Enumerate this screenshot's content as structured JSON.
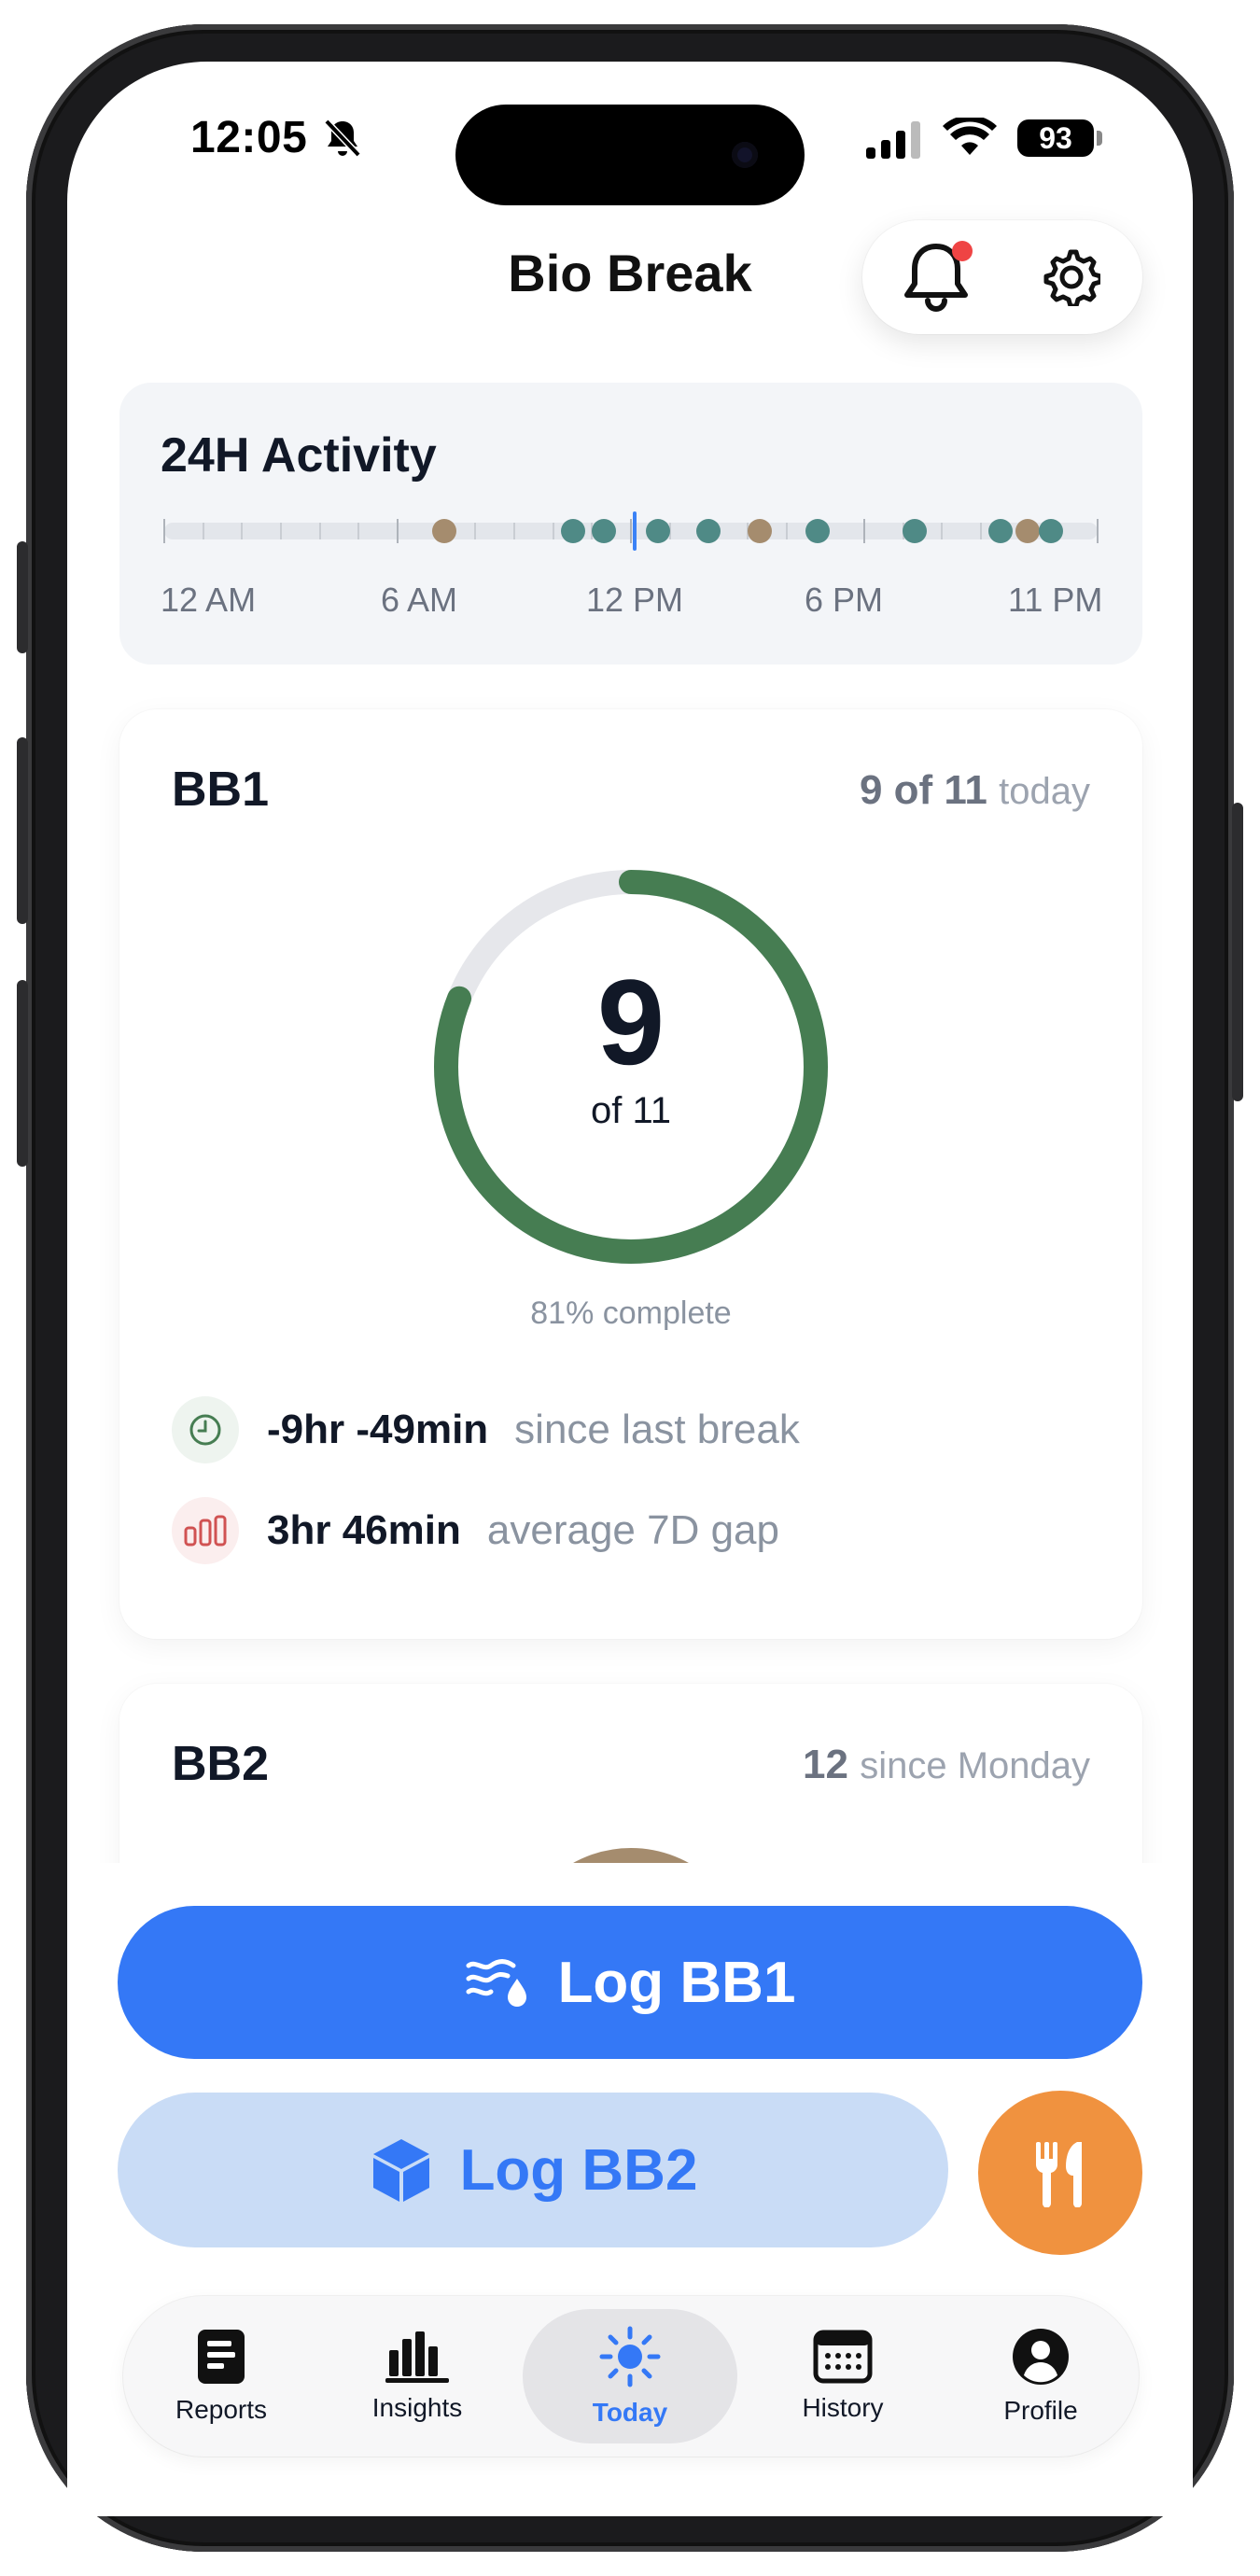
{
  "status_bar": {
    "time": "12:05",
    "battery": "93"
  },
  "header": {
    "title": "Bio Break"
  },
  "activity": {
    "title": "24H Activity",
    "labels": [
      "12 AM",
      "6 AM",
      "12 PM",
      "6 PM",
      "11 PM"
    ],
    "events_hours": [
      {
        "hour": 7.2,
        "type": "bb2"
      },
      {
        "hour": 10.5,
        "type": "bb1"
      },
      {
        "hour": 11.3,
        "type": "bb1"
      },
      {
        "hour": 12.7,
        "type": "bb1"
      },
      {
        "hour": 14.0,
        "type": "bb1"
      },
      {
        "hour": 15.3,
        "type": "bb2"
      },
      {
        "hour": 16.8,
        "type": "bb1"
      },
      {
        "hour": 19.3,
        "type": "bb1"
      },
      {
        "hour": 21.5,
        "type": "bb1"
      },
      {
        "hour": 22.2,
        "type": "bb2"
      },
      {
        "hour": 22.8,
        "type": "bb1"
      }
    ],
    "now_hour": 12.1,
    "colors": {
      "bb1": "#4f8a86",
      "bb2": "#a58c6e",
      "now": "#3b82f6"
    }
  },
  "bb1": {
    "title": "BB1",
    "count": "9 of 11",
    "count_suffix": "today",
    "ring_value": "9",
    "ring_of": "of 11",
    "progress": 0.81,
    "percent_text": "81% complete",
    "since_last_value": "-9hr -49min",
    "since_last_label": "since last break",
    "avg_gap_value": "3hr 46min",
    "avg_gap_label": "average 7D gap",
    "ring_color": "#467d52"
  },
  "bb2": {
    "title": "BB2",
    "count": "12",
    "count_suffix": "since Monday"
  },
  "actions": {
    "log_bb1": "Log BB1",
    "log_bb2": "Log BB2"
  },
  "tabs": {
    "reports": "Reports",
    "insights": "Insights",
    "today": "Today",
    "history": "History",
    "profile": "Profile"
  }
}
